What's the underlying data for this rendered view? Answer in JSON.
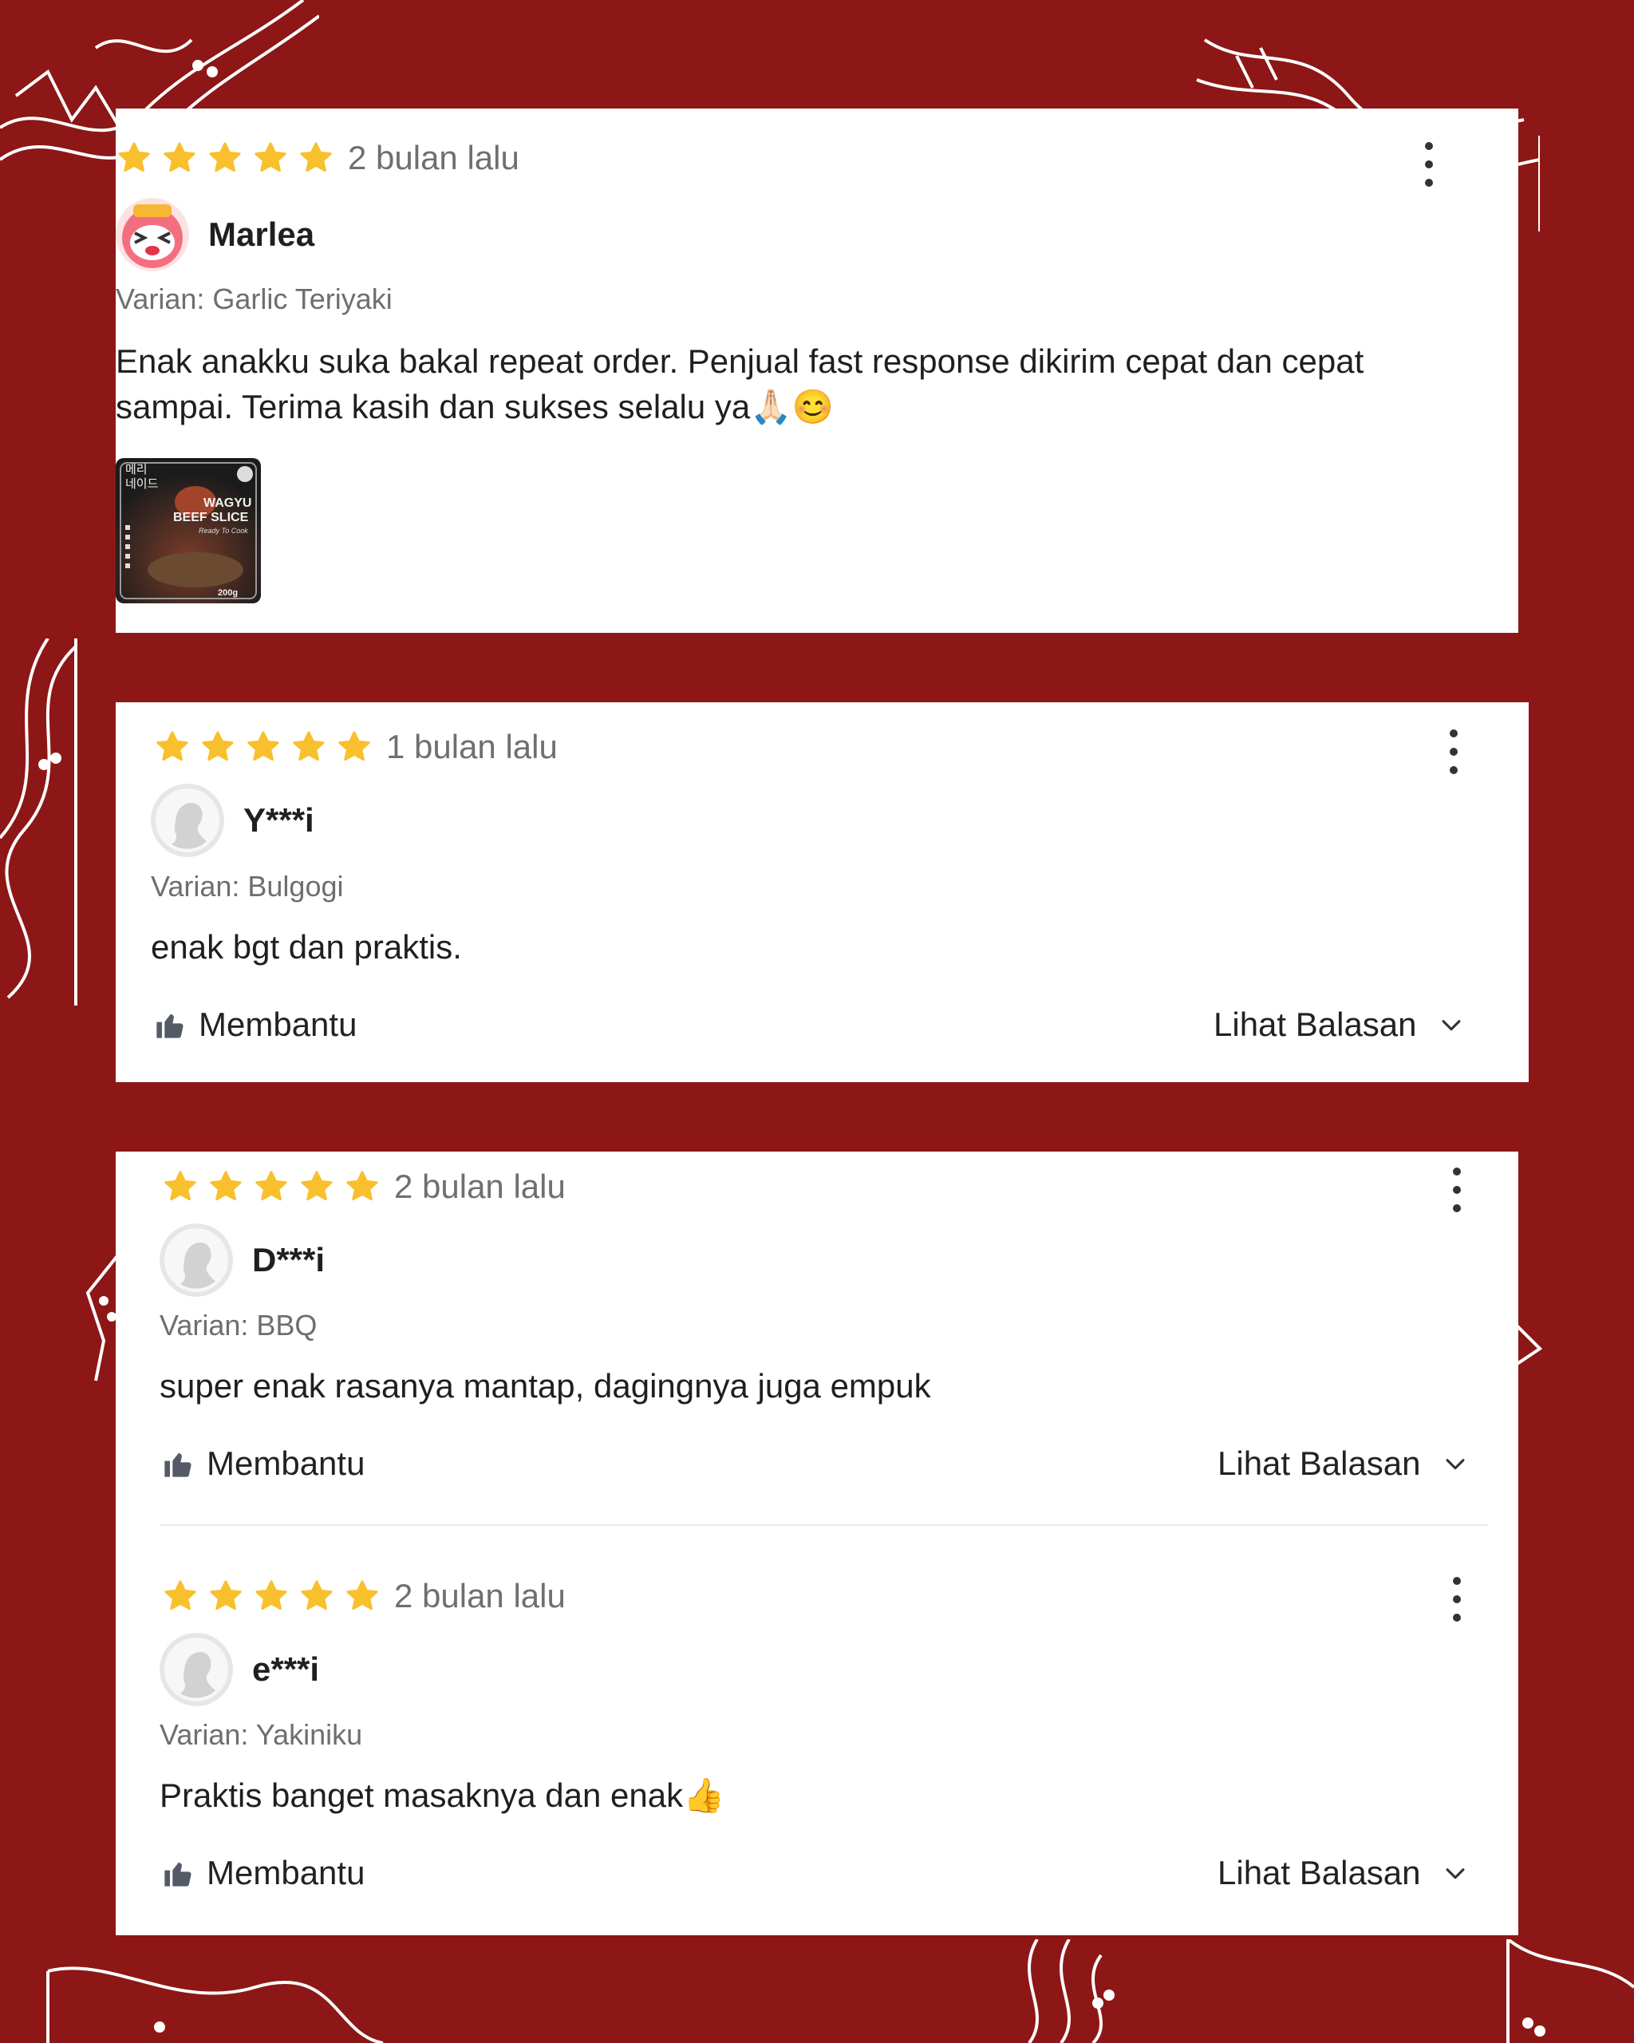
{
  "theme": {
    "background": "#8c1716",
    "star": "#f8c02c",
    "card": "#ffffff"
  },
  "reviews": [
    {
      "rating": 5,
      "time": "2 bulan lalu",
      "user": "Marlea",
      "avatar": "pink-cartoon-avatar",
      "variant": "Varian: Garlic Teriyaki",
      "text": "Enak anakku suka bakal repeat order. Penjual fast response dikirim cepat dan cepat sampai. Terima kasih dan sukses selalu ya🙏🏻😊",
      "photo": {
        "korean": "메리\n네이드",
        "title_line1": "WAGYU",
        "title_line2": "BEEF SLICE",
        "tagline": "Ready To Cook",
        "weight": "200g"
      }
    },
    {
      "rating": 5,
      "time": "1 bulan lalu",
      "user": "Y***i",
      "variant": "Varian: Bulgogi",
      "text": "enak bgt dan praktis.",
      "helpful": "Membantu",
      "replies": "Lihat Balasan"
    },
    {
      "rating": 5,
      "time": "2 bulan lalu",
      "user": "D***i",
      "variant": "Varian: BBQ",
      "text": "super enak rasanya mantap, dagingnya juga empuk",
      "helpful": "Membantu",
      "replies": "Lihat Balasan"
    },
    {
      "rating": 5,
      "time": "2 bulan lalu",
      "user": "e***i",
      "variant": "Varian: Yakiniku",
      "text": "Praktis banget masaknya dan enak👍",
      "helpful": "Membantu",
      "replies": "Lihat Balasan"
    }
  ]
}
